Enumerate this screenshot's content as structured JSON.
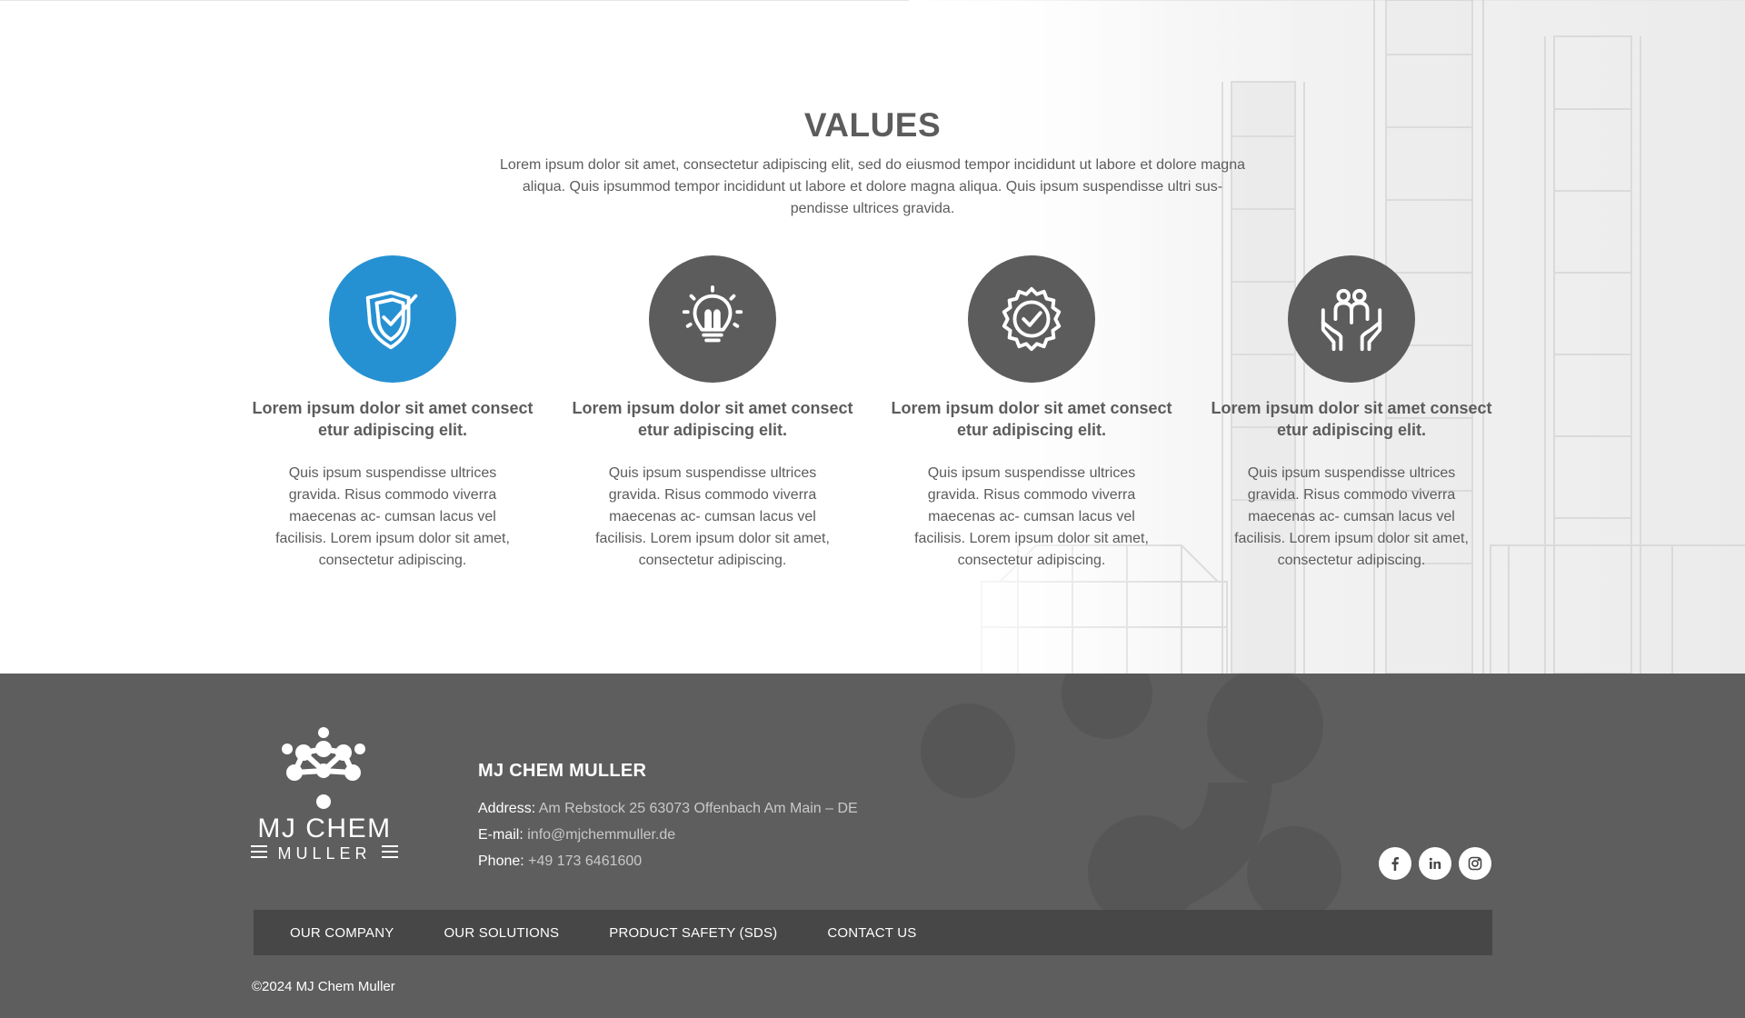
{
  "values": {
    "title": "VALUES",
    "intro": "Lorem ipsum dolor sit amet, consectetur adipiscing elit, sed do eiusmod tempor incididunt ut labore et dolore magna aliqua. Quis ipsummod tempor incididunt ut labore et dolore magna aliqua. Quis ipsum suspendisse ultri sus- pendisse ultrices gravida.",
    "cards": [
      {
        "icon": "shield-check-icon",
        "active": true,
        "title": "Lorem ipsum dolor sit amet consect etur adipiscing elit.",
        "text": "Quis ipsum suspendisse ultrices gravida. Risus commodo viverra maecenas ac- cumsan lacus vel facilisis. Lorem ipsum dolor sit amet, consectetur adipiscing."
      },
      {
        "icon": "lightbulb-icon",
        "active": false,
        "title": "Lorem ipsum dolor sit amet consect etur adipiscing elit.",
        "text": "Quis ipsum suspendisse ultrices gravida. Risus commodo viverra maecenas ac- cumsan lacus vel facilisis. Lorem ipsum dolor sit amet, consectetur adipiscing."
      },
      {
        "icon": "badge-check-icon",
        "active": false,
        "title": "Lorem ipsum dolor sit amet consect etur adipiscing elit.",
        "text": "Quis ipsum suspendisse ultrices gravida. Risus commodo viverra maecenas ac- cumsan lacus vel facilisis. Lorem ipsum dolor sit amet, consectetur adipiscing."
      },
      {
        "icon": "people-hands-icon",
        "active": false,
        "title": "Lorem ipsum dolor sit amet consect etur adipiscing elit.",
        "text": "Quis ipsum suspendisse ultrices gravida. Risus commodo viverra maecenas ac- cumsan lacus vel facilisis. Lorem ipsum dolor sit amet, consectetur adipiscing."
      }
    ]
  },
  "footer": {
    "logo": {
      "line1": "MJ CHEM",
      "line2": "MULLER"
    },
    "company_name": "MJ CHEM MULLER",
    "address_label": "Address:",
    "address_value": "Am Rebstock 25 63073 Offenbach Am Main – DE",
    "email_label": "E-mail:",
    "email_value": "info@mjchemmuller.de",
    "phone_label": "Phone:",
    "phone_value": "+49 173 6461600",
    "social": [
      "facebook-icon",
      "linkedin-icon",
      "instagram-icon"
    ],
    "nav": [
      "OUR COMPANY",
      "OUR SOLUTIONS",
      "PRODUCT SAFETY (SDS)",
      "CONTACT US"
    ],
    "copyright": "©2024 MJ Chem Muller"
  },
  "colors": {
    "accent": "#2691d2",
    "icon_circle": "#5c5c5c",
    "footer_bg": "#5e5e5e",
    "nav_bg": "#474747"
  }
}
